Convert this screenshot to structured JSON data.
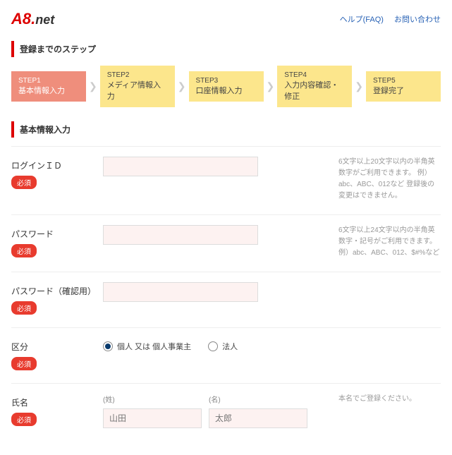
{
  "header": {
    "logo_a8": "A8",
    "logo_dot": ".",
    "logo_net": "net",
    "help": "ヘルプ(FAQ)",
    "contact": "お問い合わせ"
  },
  "steps_title": "登録までのステップ",
  "steps": [
    {
      "num": "STEP1",
      "label": "基本情報入力"
    },
    {
      "num": "STEP2",
      "label": "メディア情報入力"
    },
    {
      "num": "STEP3",
      "label": "口座情報入力"
    },
    {
      "num": "STEP4",
      "label": "入力内容確認・修正"
    },
    {
      "num": "STEP5",
      "label": "登録完了"
    }
  ],
  "form_title": "基本情報入力",
  "required_label": "必須",
  "fields": {
    "login_id": {
      "label": "ログインＩＤ",
      "value": "",
      "hint": "6文字以上20文字以内の半角英数字がご利用できます。\n例）abc、ABC、012など\n登録後の変更はできません。"
    },
    "password": {
      "label": "パスワード",
      "value": "",
      "hint": "6文字以上24文字以内の半角英数字・記号がご利用できます。\n例）abc、ABC、012、$#%など"
    },
    "password_confirm": {
      "label": "パスワード（確認用）",
      "value": ""
    },
    "category": {
      "label": "区分",
      "option1": "個人 又は 個人事業主",
      "option2": "法人"
    },
    "name": {
      "label": "氏名",
      "sub1": "(姓)",
      "sub2": "(名)",
      "placeholder1": "山田",
      "placeholder2": "太郎",
      "hint": "本名でご登録ください。"
    }
  }
}
